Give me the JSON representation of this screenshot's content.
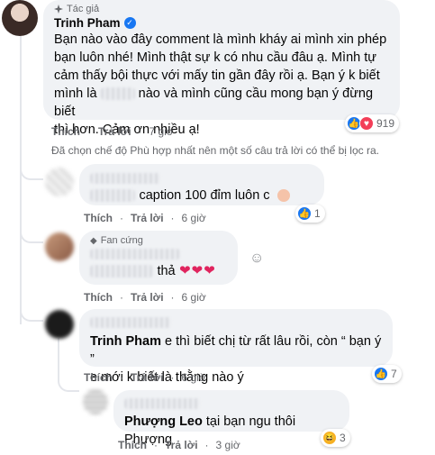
{
  "post_comment": {
    "author_badge": "Tác giả",
    "author_name": "Trinh Pham",
    "text": "Bạn nào vào đây comment là mình kháy ai mình xin phép bạn luôn nhé! Mình thật sự k có nhu cầu đâu ạ. Mình tự cảm thấy bội thực với mấy tin gần đây rồi ạ. Bạn ý k biết mình là [censored] nào và mình cũng cầu mong bạn ý đừng biết thì hơn. Cảm ơn nhiều ạ!",
    "text_lines": [
      "Bạn nào vào đây comment là mình kháy ai mình xin phép",
      "bạn luôn nhé! Mình thật sự k có nhu cầu đâu ạ. Mình tự",
      "cảm thấy bội thực với mấy tin gần đây rồi ạ. Bạn ý k biết",
      "mình là",
      "nào và mình cũng cầu mong bạn ý đừng biết",
      "thì hơn. Cảm ơn nhiều ạ!"
    ],
    "like_label": "Thích",
    "reply_label": "Trả lời",
    "time": "7 giờ",
    "reaction_count": "919"
  },
  "filter_notice": "Đã chọn chế độ Phù hợp nhất nên một số câu trả lời có thể bị lọc ra.",
  "replies": [
    {
      "text_visible": "caption 100 đỉm luôn c",
      "like_label": "Thích",
      "reply_label": "Trả lời",
      "time": "6 giờ",
      "reaction_count": "1"
    },
    {
      "badge": "Fan cứng",
      "text_visible": "thả",
      "hearts": "❤❤❤",
      "like_label": "Thích",
      "reply_label": "Trả lời",
      "time": "6 giờ"
    },
    {
      "mention": "Trinh Pham",
      "text_line1": "e thì biết chị từ rất lâu rồi, còn “ bạn ý ”",
      "text_line2": "e mới k biết là thằng nào ý",
      "like_label": "Thích",
      "reply_label": "Trả lời",
      "time": "6 giờ",
      "reaction_count": "7"
    },
    {
      "mention": "Phượng Leo",
      "text": "tại bạn ngu thôi Phượng",
      "like_label": "Thích",
      "reply_label": "Trả lời",
      "time": "3 giờ",
      "reaction_count": "3"
    }
  ],
  "colors": {
    "bubble": "#f0f2f5",
    "meta": "#65676b",
    "like_blue": "#1877f2",
    "love_red": "#f33e58",
    "haha_yellow": "#f7b125"
  },
  "icons": [
    "verified-icon",
    "like-reaction-icon",
    "love-reaction-icon",
    "haha-reaction-icon",
    "fan-diamond-icon",
    "emoji-icon"
  ]
}
